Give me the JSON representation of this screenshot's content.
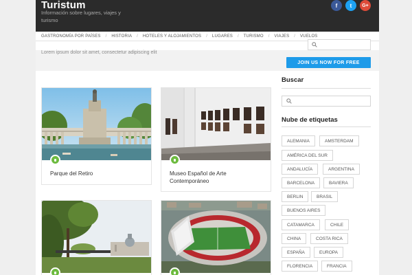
{
  "site": {
    "title": "Turistum",
    "tagline": "Información sobre lugares, viajes y turismo"
  },
  "social": [
    {
      "icon": "facebook-icon",
      "glyph": "f",
      "color": "#3b5998"
    },
    {
      "icon": "twitter-icon",
      "glyph": "t",
      "color": "#1da1f2"
    },
    {
      "icon": "google-plus-icon",
      "glyph": "G+",
      "color": "#dd4b39"
    }
  ],
  "nav": {
    "items": [
      "Gastronomía por países",
      "Historia",
      "Hoteles y alojamientos",
      "Lugares",
      "Turismo",
      "Viajes",
      "Vuelos"
    ]
  },
  "topbar": {
    "text": "Lorem ipsum dolor sit amet, consectetur adipiscing elit",
    "cta": "Join us now for free",
    "cta_color": "#1e9be9"
  },
  "posts": [
    {
      "title": "Parque del Retiro"
    },
    {
      "title": "Museo Español de Arte Contemporáneo"
    },
    {
      "title": ""
    },
    {
      "title": ""
    }
  ],
  "sidebar": {
    "search_title": "Buscar",
    "tags_title": "Nube de etiquetas",
    "tags": [
      "Alemania",
      "Amsterdam",
      "América del Sur",
      "Andalucía",
      "Argentina",
      "Barcelona",
      "Baviera",
      "Berlin",
      "Brasil",
      "Buenos Aires",
      "Catamarca",
      "Chile",
      "China",
      "Costa Rica",
      "España",
      "Europa",
      "Florencia",
      "Francia"
    ]
  },
  "colors": {
    "header_bg": "#2b2b2b",
    "accent_green": "#6dbb3f"
  }
}
